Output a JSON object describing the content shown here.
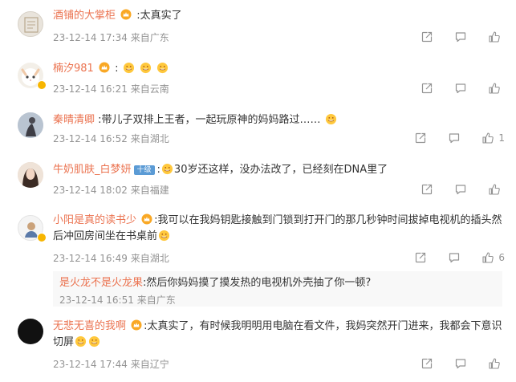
{
  "comments": [
    {
      "username": "酒铺的大掌柜",
      "text": ":太真实了",
      "time": "23-12-14 17:34",
      "location": "来自广东",
      "likes": ""
    },
    {
      "username": "楠汐981",
      "text": ":",
      "time": "23-12-14 16:21",
      "location": "来自云南",
      "likes": ""
    },
    {
      "username": "秦晴清卿",
      "text": ":带儿子双排上王者，一起玩原神的妈妈路过……",
      "time": "23-12-14 16:52",
      "location": "来自湖北",
      "likes": "1"
    },
    {
      "username": "牛奶肌肤_白梦妍",
      "tag": "十级",
      "text": "30岁还这样，没办法改了，已经刻在DNA里了",
      "time": "23-12-14 18:02",
      "location": "来自福建",
      "likes": ""
    },
    {
      "username": "小阳是真的读书少",
      "text": ":我可以在我妈钥匙接触到门锁到打开门的那几秒钟时间拔掉电视机的插头然后冲回房间坐在书桌前",
      "time": "23-12-14 16:49",
      "location": "来自湖北",
      "likes": "6"
    },
    {
      "username": "无悲无喜的我啊",
      "text": ":太真实了，有时候我明明用电脑在看文件，我妈突然开门进来，我都会下意识切屏",
      "time": "23-12-14 17:44",
      "location": "来自辽宁",
      "likes": ""
    }
  ],
  "reply": {
    "username": "是火龙不是火龙果",
    "text": ":然后你妈妈摸了摸发热的电视机外壳抽了你一顿?",
    "time": "23-12-14 16:51",
    "location": "来自广东"
  },
  "icons": {
    "share": "share-icon",
    "comment": "comment-icon",
    "like": "thumbs-up-icon",
    "vip": "crown-icon",
    "emoji": "emoji-icon"
  },
  "colors": {
    "username": "#eb7350",
    "meta": "#939393",
    "text": "#333333",
    "reply_bg": "#f8f8f8",
    "vip": "#f7b500"
  }
}
